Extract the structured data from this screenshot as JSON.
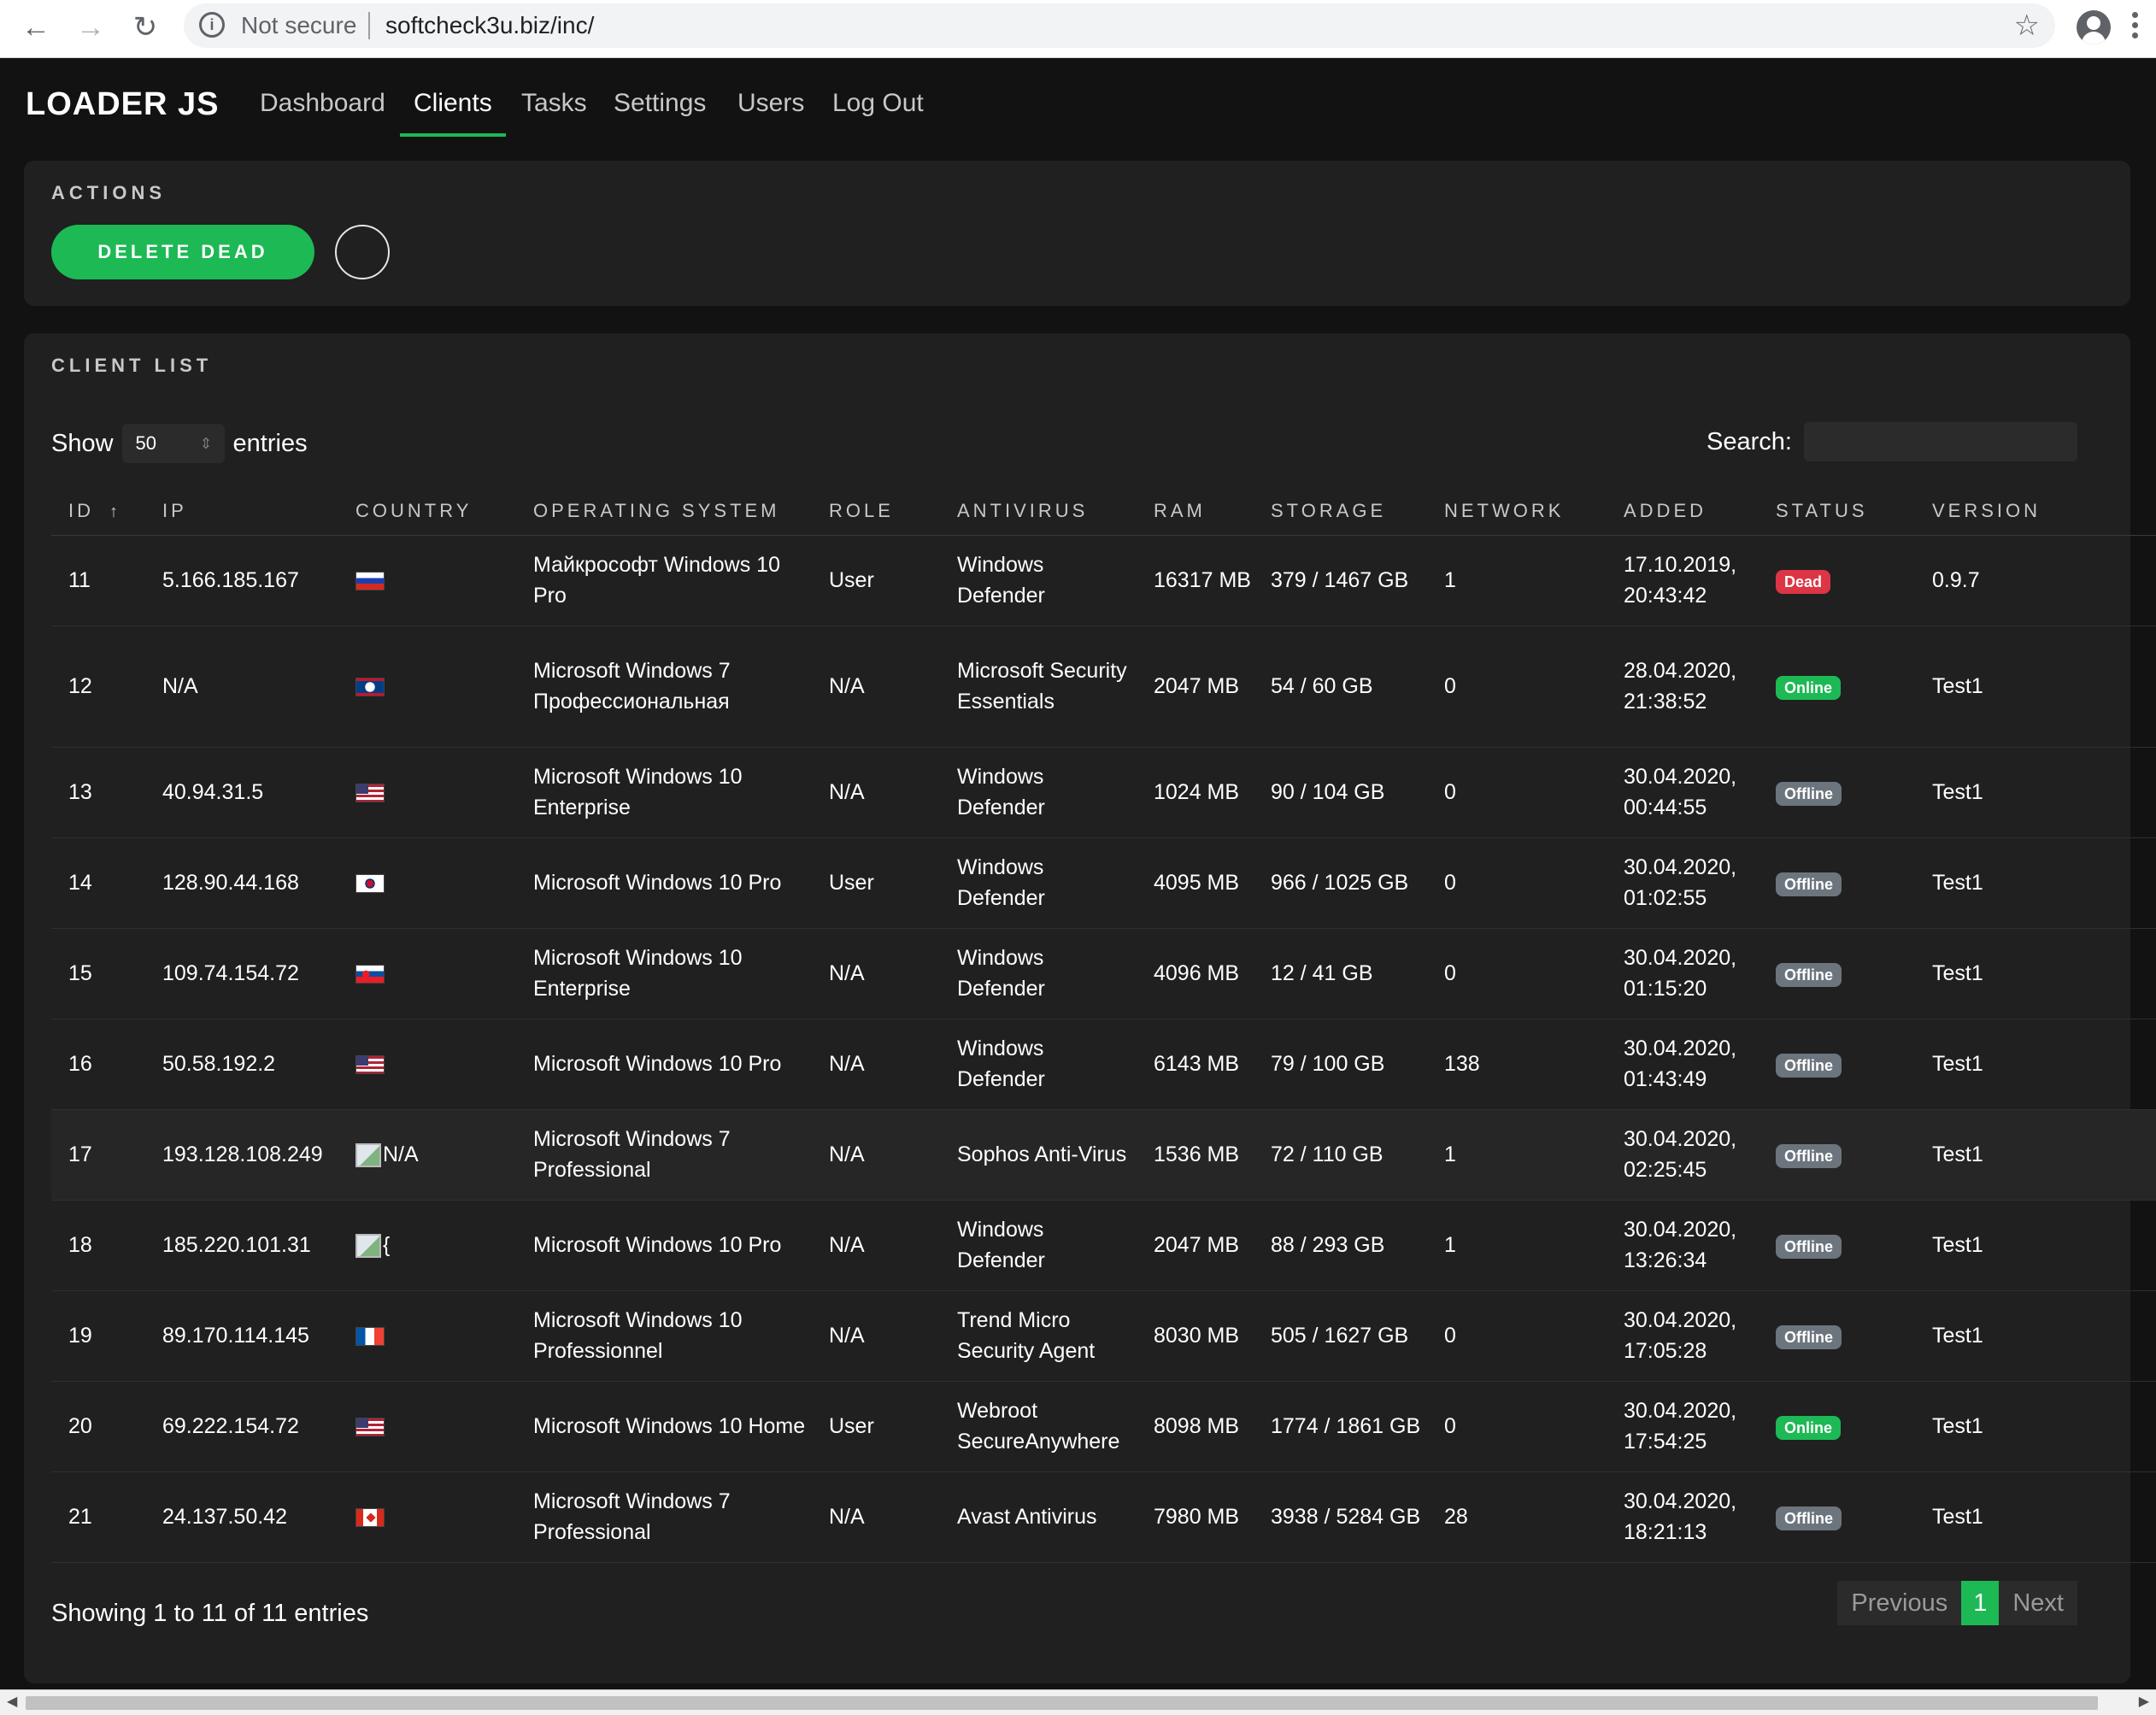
{
  "browser": {
    "back_icon": "back-arrow-icon",
    "forward_icon": "forward-arrow-icon",
    "reload_icon": "reload-icon",
    "security_label": "Not secure",
    "url": "softcheck3u.biz/inc/"
  },
  "app": {
    "brand": "LOADER JS",
    "nav": [
      {
        "label": "Dashboard"
      },
      {
        "label": "Clients",
        "active": true
      },
      {
        "label": "Tasks"
      },
      {
        "label": "Settings"
      },
      {
        "label": "Users"
      },
      {
        "label": "Log Out"
      }
    ],
    "accent_color": "#1db954"
  },
  "actions": {
    "title": "ACTIONS",
    "delete_dead_label": "DELETE DEAD"
  },
  "client_list": {
    "title": "CLIENT LIST",
    "show_label": "Show",
    "entries_value": "50",
    "entries_label": "entries",
    "search_label": "Search:",
    "search_value": "",
    "columns": [
      "ID",
      "IP",
      "COUNTRY",
      "OPERATING SYSTEM",
      "ROLE",
      "ANTIVIRUS",
      "RAM",
      "STORAGE",
      "NETWORK",
      "ADDED",
      "STATUS",
      "VERSION"
    ],
    "sort_indicator": "↑",
    "rows": [
      {
        "id": "11",
        "ip": "5.166.185.167",
        "country": "ru",
        "country_text": "",
        "os": "Майкрософт Windows 10 Pro",
        "role": "User",
        "av": "Windows Defender",
        "ram": "16317 MB",
        "storage": "379 / 1467 GB",
        "network": "1",
        "added": "17.10.2019, 20:43:42",
        "status": "Dead",
        "version": "0.9.7"
      },
      {
        "id": "12",
        "ip": "N/A",
        "country": "bz",
        "country_text": "",
        "os": "Microsoft Windows 7 Профессиональная",
        "role": "N/A",
        "av": "Microsoft Security Essentials",
        "ram": "2047 MB",
        "storage": "54 / 60 GB",
        "network": "0",
        "added": "28.04.2020, 21:38:52",
        "status": "Online",
        "version": "Test1"
      },
      {
        "id": "13",
        "ip": "40.94.31.5",
        "country": "us",
        "country_text": "",
        "os": "Microsoft Windows 10 Enterprise",
        "role": "N/A",
        "av": "Windows Defender",
        "ram": "1024 MB",
        "storage": "90 / 104 GB",
        "network": "0",
        "added": "30.04.2020, 00:44:55",
        "status": "Offline",
        "version": "Test1"
      },
      {
        "id": "14",
        "ip": "128.90.44.168",
        "country": "kr",
        "country_text": "",
        "os": "Microsoft Windows 10 Pro",
        "role": "User",
        "av": "Windows Defender",
        "ram": "4095 MB",
        "storage": "966 / 1025 GB",
        "network": "0",
        "added": "30.04.2020, 01:02:55",
        "status": "Offline",
        "version": "Test1"
      },
      {
        "id": "15",
        "ip": "109.74.154.72",
        "country": "sk",
        "country_text": "",
        "os": "Microsoft Windows 10 Enterprise",
        "role": "N/A",
        "av": "Windows Defender",
        "ram": "4096 MB",
        "storage": "12 / 41 GB",
        "network": "0",
        "added": "30.04.2020, 01:15:20",
        "status": "Offline",
        "version": "Test1"
      },
      {
        "id": "16",
        "ip": "50.58.192.2",
        "country": "us",
        "country_text": "",
        "os": "Microsoft Windows 10 Pro",
        "role": "N/A",
        "av": "Windows Defender",
        "ram": "6143 MB",
        "storage": "79 / 100 GB",
        "network": "138",
        "added": "30.04.2020, 01:43:49",
        "status": "Offline",
        "version": "Test1"
      },
      {
        "id": "17",
        "ip": "193.128.108.249",
        "country": "broken",
        "country_text": "N/A",
        "os": "Microsoft Windows 7 Professional",
        "role": "N/A",
        "av": "Sophos Anti-Virus",
        "ram": "1536 MB",
        "storage": "72 / 110 GB",
        "network": "1",
        "added": "30.04.2020, 02:25:45",
        "status": "Offline",
        "version": "Test1"
      },
      {
        "id": "18",
        "ip": "185.220.101.31",
        "country": "broken",
        "country_text": "{",
        "os": "Microsoft Windows 10 Pro",
        "role": "N/A",
        "av": "Windows Defender",
        "ram": "2047 MB",
        "storage": "88 / 293 GB",
        "network": "1",
        "added": "30.04.2020, 13:26:34",
        "status": "Offline",
        "version": "Test1"
      },
      {
        "id": "19",
        "ip": "89.170.114.145",
        "country": "fr",
        "country_text": "",
        "os": "Microsoft Windows 10 Professionnel",
        "role": "N/A",
        "av": "Trend Micro Security Agent",
        "ram": "8030 MB",
        "storage": "505 / 1627 GB",
        "network": "0",
        "added": "30.04.2020, 17:05:28",
        "status": "Offline",
        "version": "Test1"
      },
      {
        "id": "20",
        "ip": "69.222.154.72",
        "country": "us",
        "country_text": "",
        "os": "Microsoft Windows 10 Home",
        "role": "User",
        "av": "Webroot SecureAnywhere",
        "ram": "8098 MB",
        "storage": "1774 / 1861 GB",
        "network": "0",
        "added": "30.04.2020, 17:54:25",
        "status": "Online",
        "version": "Test1"
      },
      {
        "id": "21",
        "ip": "24.137.50.42",
        "country": "ca",
        "country_text": "",
        "os": "Microsoft Windows 7 Professional",
        "role": "N/A",
        "av": "Avast Antivirus",
        "ram": "7980 MB",
        "storage": "3938 / 5284 GB",
        "network": "28",
        "added": "30.04.2020, 18:21:13",
        "status": "Offline",
        "version": "Test1"
      }
    ],
    "showing_text": "Showing 1 to 11 of 11 entries",
    "pager": {
      "previous": "Previous",
      "current": "1",
      "next": "Next"
    }
  }
}
